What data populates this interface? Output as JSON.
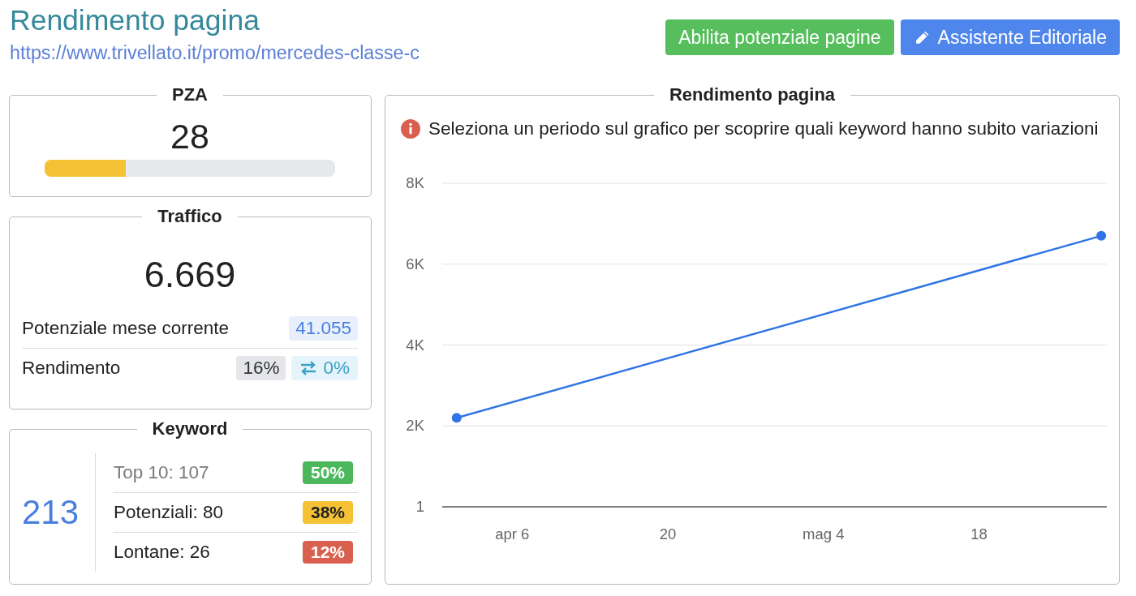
{
  "header": {
    "title": "Rendimento pagina",
    "url": "https://www.trivellato.it/promo/mercedes-classe-c"
  },
  "actions": [
    {
      "label": "Abilita potenziale pagine",
      "kind": "success",
      "icon": false
    },
    {
      "label": "Assistente Editoriale",
      "kind": "primary",
      "icon": true
    }
  ],
  "pza": {
    "title": "PZA",
    "value": "28",
    "level": 0.28
  },
  "traffic": {
    "title": "Traffico",
    "value": "6.669",
    "rows": [
      {
        "label": "Potenziale mese corrente",
        "badges": [
          {
            "text": "41.055",
            "kind": "primary"
          }
        ]
      },
      {
        "label": "Rendimento",
        "badges": [
          {
            "text": "16%",
            "kind": "secondary"
          },
          {
            "text": "0%",
            "kind": "trend"
          }
        ]
      }
    ]
  },
  "keywords": {
    "title": "Keyword",
    "total": "213",
    "rows": [
      {
        "label": "Top 10: 107",
        "dimmed": true,
        "badge": "50%",
        "color": "#4cb85c"
      },
      {
        "label": "Potenziali: 80",
        "dimmed": false,
        "badge": "38%",
        "color": "#f5c236"
      },
      {
        "label": "Lontane: 26",
        "dimmed": false,
        "badge": "12%",
        "color": "#d9604f"
      }
    ]
  },
  "chart_panel": {
    "title": "Rendimento pagina",
    "notice": "Seleziona un periodo sul grafico per scoprire quali keyword hanno subito variazioni",
    "chart_data": {
      "type": "line",
      "grid": true,
      "categories": [
        null,
        null,
        null,
        null,
        null,
        "apr 6",
        null,
        null,
        null,
        null,
        null,
        null,
        null,
        null,
        null,
        null,
        null,
        null,
        null,
        "20",
        null,
        null,
        null,
        null,
        null,
        null,
        null,
        null,
        null,
        null,
        null,
        null,
        null,
        "mag 4",
        null,
        null,
        null,
        null,
        null,
        null,
        null,
        null,
        null,
        null,
        null,
        null,
        null,
        "18",
        null,
        null,
        null,
        null,
        null,
        null,
        null,
        null,
        null,
        null,
        null
      ],
      "series": [
        {
          "color": "#2f74e6",
          "marker": true,
          "values": [
            2200,
            null,
            null,
            null,
            null,
            null,
            null,
            null,
            null,
            null,
            null,
            null,
            null,
            null,
            null,
            null,
            null,
            null,
            null,
            null,
            null,
            null,
            null,
            null,
            null,
            null,
            null,
            null,
            null,
            null,
            null,
            null,
            null,
            null,
            null,
            null,
            null,
            null,
            null,
            null,
            null,
            null,
            null,
            null,
            null,
            null,
            null,
            null,
            null,
            null,
            null,
            null,
            null,
            null,
            null,
            null,
            null,
            null,
            6700
          ]
        }
      ],
      "ylim": [
        1,
        8000
      ],
      "yticks": [
        {
          "value": 1,
          "label": "1"
        },
        {
          "value": 2000,
          "label": "2K"
        },
        {
          "value": 4000,
          "label": "4K"
        },
        {
          "value": 6000,
          "label": "6K"
        },
        {
          "value": 8000,
          "label": "8K"
        }
      ]
    }
  }
}
